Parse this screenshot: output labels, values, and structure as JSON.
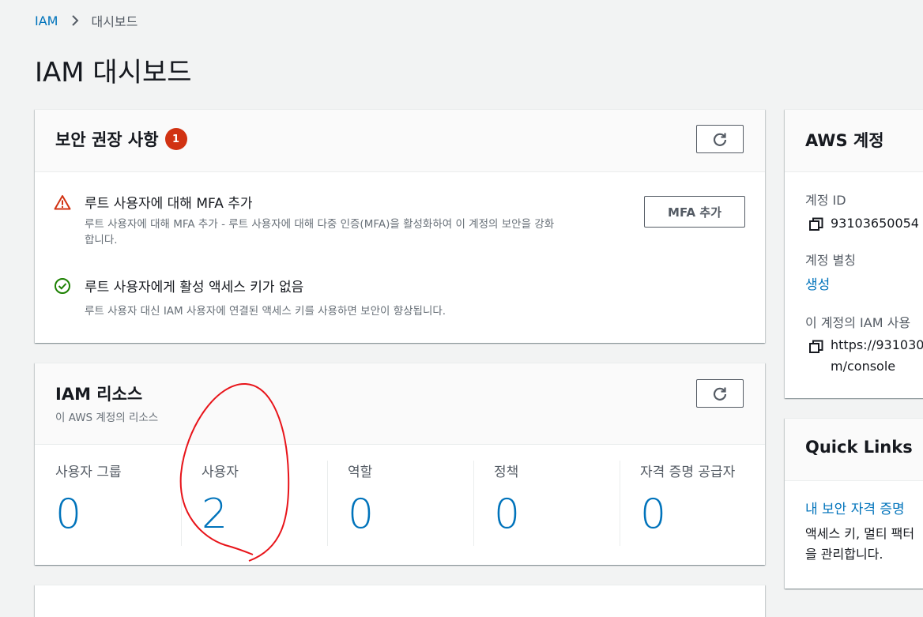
{
  "breadcrumb": {
    "root": "IAM",
    "current": "대시보드"
  },
  "page_title": "IAM 대시보드",
  "security_panel": {
    "title": "보안 권장 사항",
    "badge_count": "1",
    "items": [
      {
        "status": "warning",
        "title": "루트 사용자에 대해 MFA 추가",
        "desc_line1": "루트 사용자에 대해 MFA 추가 - 루트 사용자에 대해 다중 인증(MFA)을 활성화하여 이 계정의 보안을 강화",
        "desc_line2": "합니다.",
        "action_label": "MFA 추가"
      },
      {
        "status": "success",
        "title": "루트 사용자에게 활성 액세스 키가 없음",
        "desc_line1": "루트 사용자 대신 IAM 사용자에 연결된 액세스 키를 사용하면 보안이 향상됩니다."
      }
    ]
  },
  "resources_panel": {
    "title": "IAM 리소스",
    "subtitle": "이 AWS 계정의 리소스",
    "columns": [
      {
        "label": "사용자 그룹",
        "value": "0"
      },
      {
        "label": "사용자",
        "value": "2"
      },
      {
        "label": "역할",
        "value": "0"
      },
      {
        "label": "정책",
        "value": "0"
      },
      {
        "label": "자격 증명 공급자",
        "value": "0"
      }
    ]
  },
  "account_panel": {
    "title": "AWS 계정",
    "account_id_label": "계정 ID",
    "account_id_value": "93103650054",
    "alias_label": "계정 별칭",
    "alias_link": "생성",
    "signin_label": "이 계정의 IAM 사용",
    "signin_url_line1": "https://931030",
    "signin_url_line2": "m/console"
  },
  "quick_links_panel": {
    "title": "Quick Links",
    "link_label": "내 보안 자격 증명",
    "desc_line1": "액세스 키, 멀티 팩터",
    "desc_line2": "을 관리합니다."
  },
  "colors": {
    "link": "#0073bb",
    "badge": "#d13212",
    "warning": "#d13212",
    "success": "#1d8102",
    "annotation": "#e8141a"
  }
}
